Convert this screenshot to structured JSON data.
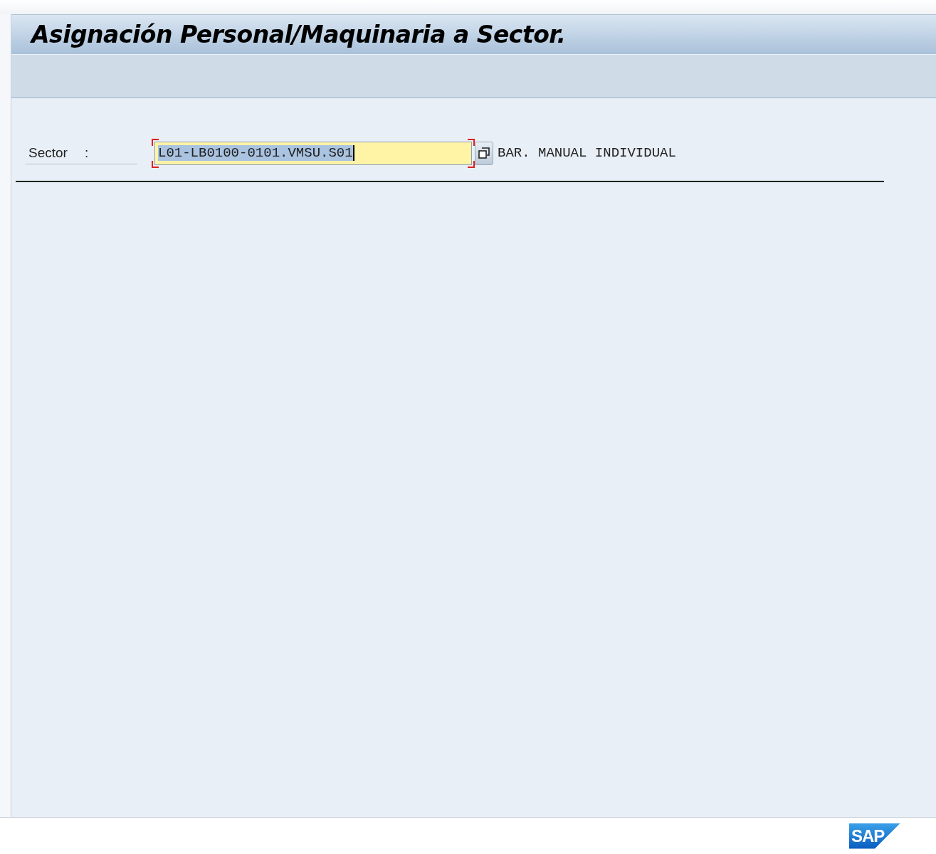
{
  "window": {
    "title": "Asignación Personal/Maquinaria a Sector."
  },
  "form": {
    "label": "Sector",
    "colon": ":",
    "field": {
      "value": "L01-LB0100-0101.VMSU.S01",
      "focused": true,
      "text_selected": true
    },
    "description": "BAR. MANUAL INDIVIDUAL"
  },
  "footer": {
    "logo": "SAP"
  }
}
